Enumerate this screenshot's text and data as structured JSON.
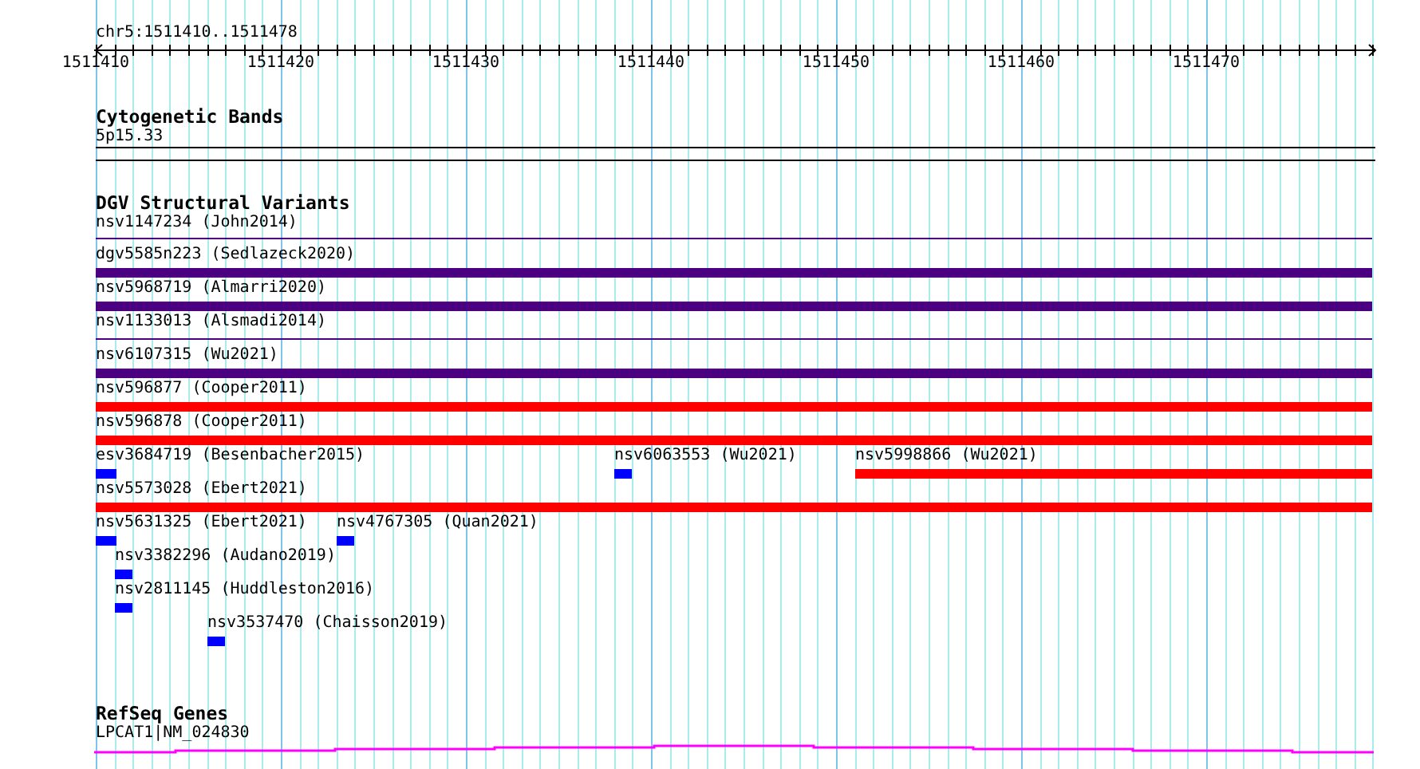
{
  "ruler": {
    "location": "chr5:1511410..1511478",
    "ticks": [
      "1511410",
      "1511420",
      "1511430",
      "1511440",
      "1511450",
      "1511460",
      "1511470"
    ]
  },
  "tracks": [
    {
      "kind": "bands",
      "title": "Cytogenetic Bands",
      "features": [
        {
          "label": "5p15.33"
        }
      ]
    },
    {
      "kind": "variants",
      "title": "DGV Structural Variants",
      "features": [
        {
          "label": "nsv1147234 (John2014)",
          "kind": "line",
          "color": "#4b0082"
        },
        {
          "label": "dgv5585n223 (Sedlazeck2020)",
          "kind": "bar",
          "color": "#4b0082"
        },
        {
          "label": "nsv5968719 (Almarri2020)",
          "kind": "bar",
          "color": "#4b0082"
        },
        {
          "label": "nsv1133013 (Alsmadi2014)",
          "kind": "line",
          "color": "#4b0082"
        },
        {
          "label": "nsv6107315 (Wu2021)",
          "kind": "bar",
          "color": "#4b0082"
        },
        {
          "label": "nsv596877 (Cooper2011)",
          "kind": "bar",
          "color": "#ff0000"
        },
        {
          "label": "nsv596878 (Cooper2011)",
          "kind": "bar",
          "color": "#ff0000"
        },
        {
          "label": "esv3684719 (Besenbacher2015)",
          "kind": "bar",
          "color": "#0000ff"
        },
        {
          "label": "nsv6063553 (Wu2021)",
          "kind": "bar",
          "color": "#0000ff"
        },
        {
          "label": "nsv5998866 (Wu2021)",
          "kind": "bar",
          "color": "#ff0000"
        },
        {
          "label": "nsv5573028 (Ebert2021)",
          "kind": "bar",
          "color": "#ff0000"
        },
        {
          "label": "nsv5631325 (Ebert2021)",
          "kind": "bar",
          "color": "#0000ff"
        },
        {
          "label": "nsv4767305 (Quan2021)",
          "kind": "bar",
          "color": "#0000ff"
        },
        {
          "label": "nsv3382296 (Audano2019)",
          "kind": "bar",
          "color": "#0000ff"
        },
        {
          "label": "nsv2811145 (Huddleston2016)",
          "kind": "bar",
          "color": "#0000ff"
        },
        {
          "label": "nsv3537470 (Chaisson2019)",
          "kind": "bar",
          "color": "#0000ff"
        }
      ]
    },
    {
      "kind": "genes",
      "title": "RefSeq Genes",
      "features": [
        {
          "label": "LPCAT1|NM_024830",
          "kind": "gene",
          "color": "#ff00ff"
        }
      ]
    }
  ]
}
